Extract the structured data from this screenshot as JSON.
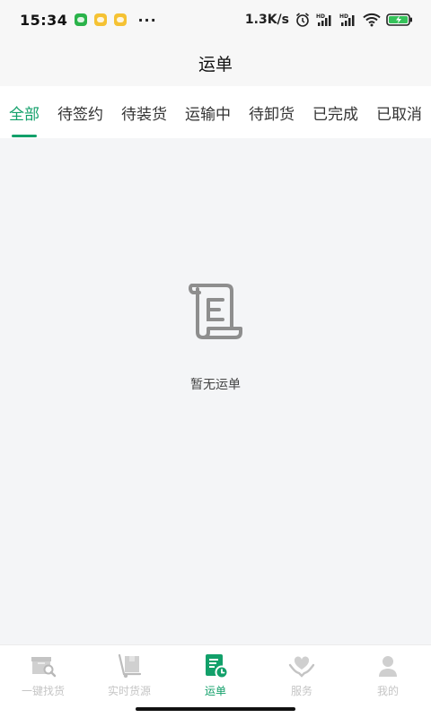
{
  "status_bar": {
    "time": "15:34",
    "more": "···",
    "net_speed": "1.3K/s",
    "app_icons": [
      "green-app-icon",
      "yellow-chat-icon",
      "yellow-message-icon"
    ],
    "right_icons": [
      "alarm-icon",
      "hd-signal-icon",
      "hd-signal-icon",
      "wifi-icon",
      "battery-charging-icon"
    ]
  },
  "header": {
    "title": "运单"
  },
  "tabs": [
    {
      "label": "全部",
      "active": true
    },
    {
      "label": "待签约"
    },
    {
      "label": "待装货"
    },
    {
      "label": "运输中"
    },
    {
      "label": "待卸货"
    },
    {
      "label": "已完成"
    },
    {
      "label": "已取消"
    }
  ],
  "empty_state": {
    "icon": "scroll-document-icon",
    "text": "暂无运单"
  },
  "bottom_nav": [
    {
      "label": "一键找货",
      "icon": "box-search-icon"
    },
    {
      "label": "实时货源",
      "icon": "cargo-cart-icon"
    },
    {
      "label": "运单",
      "icon": "waybill-clock-icon",
      "active": true
    },
    {
      "label": "服务",
      "icon": "heart-hand-icon"
    },
    {
      "label": "我的",
      "icon": "person-icon"
    }
  ],
  "colors": {
    "accent": "#12a06a",
    "inactive": "#c5c5c5",
    "page_bg": "#f4f5f7"
  }
}
